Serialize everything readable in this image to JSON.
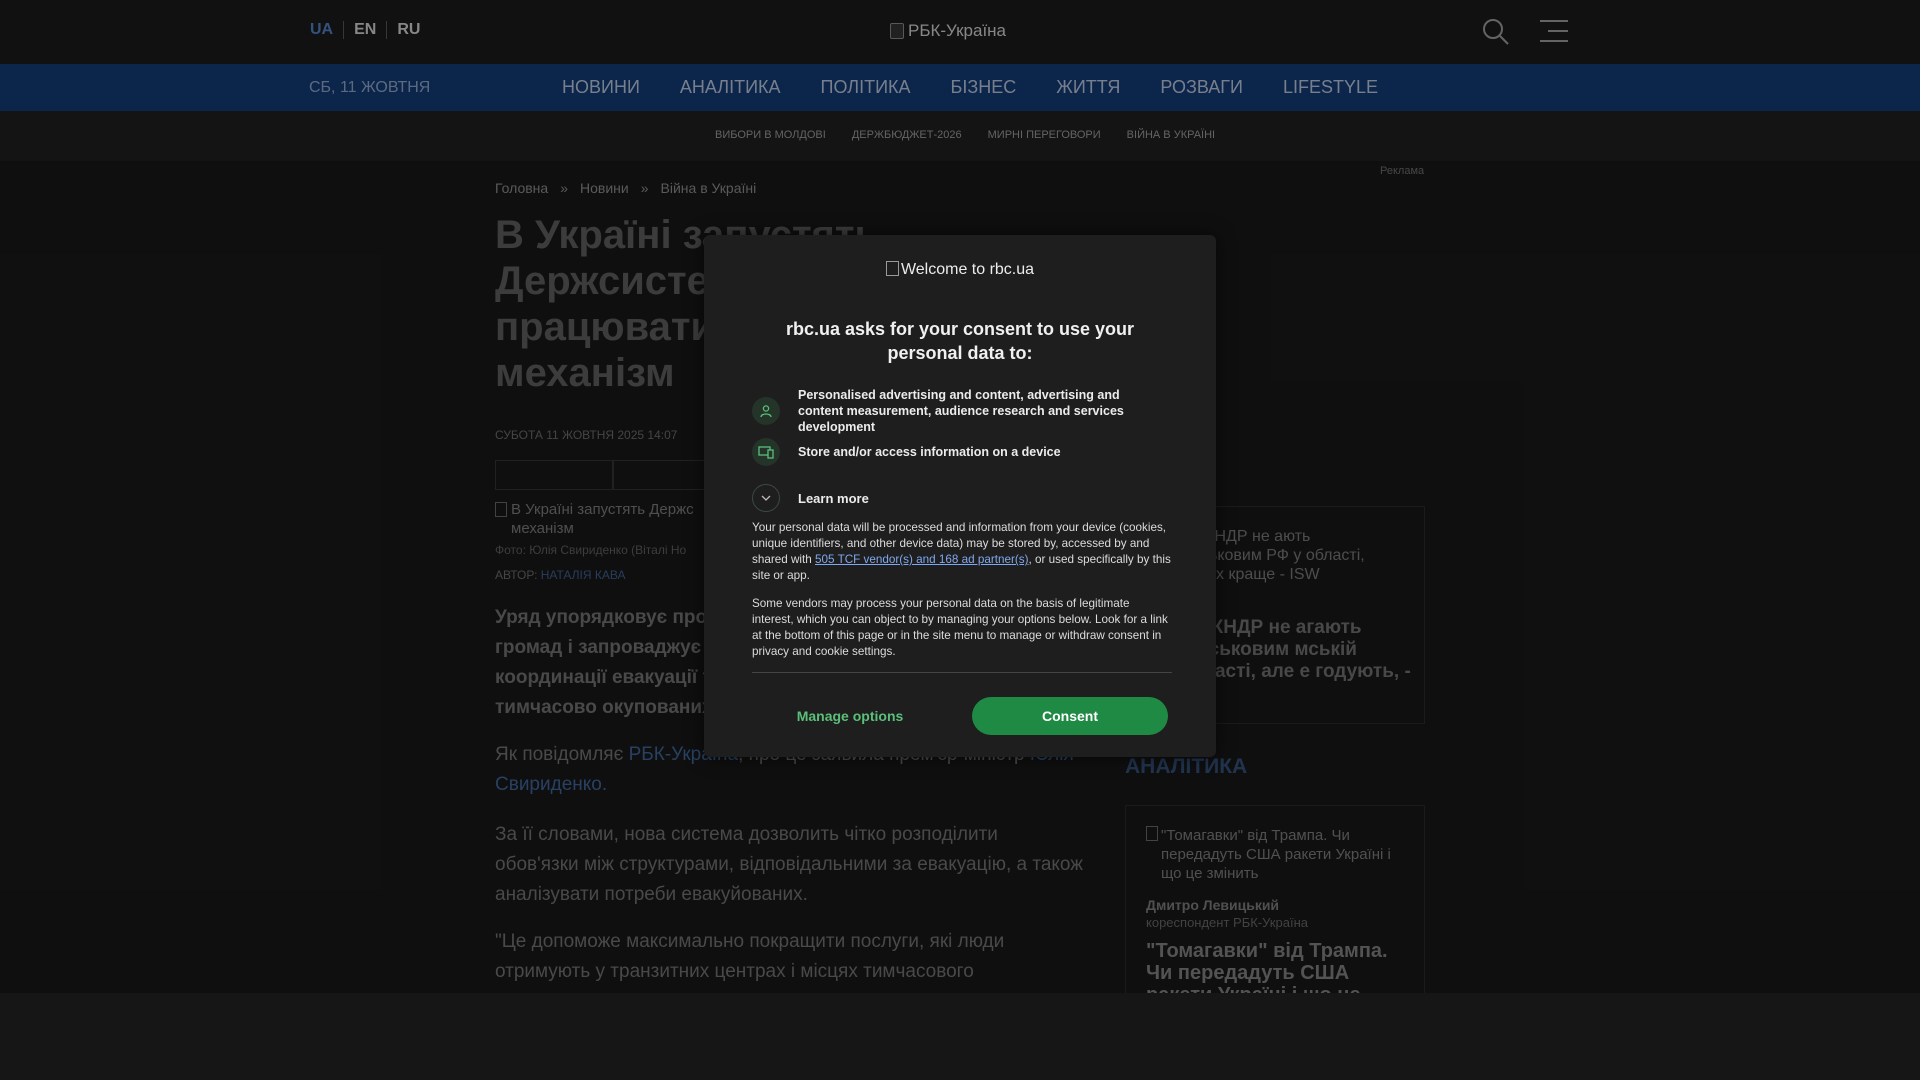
{
  "header": {
    "languages": [
      {
        "label": "UA",
        "active": true
      },
      {
        "label": "EN",
        "active": false
      },
      {
        "label": "RU",
        "active": false
      }
    ],
    "logo_alt": "РБК-Україна",
    "search_icon": "search-icon",
    "menu_icon": "hamburger-menu-icon"
  },
  "nav": {
    "date": "СБ, 11 ЖОВТНЯ",
    "items": [
      "НОВИНИ",
      "АНАЛІТИКА",
      "ПОЛІТИКА",
      "БІЗНЕС",
      "ЖИТТЯ",
      "РОЗВАГИ",
      "LIFESTYLE"
    ]
  },
  "tags": [
    "ВИБОРИ В МОЛДОВІ",
    "ДЕРЖБЮДЖЕТ-2026",
    "МИРНІ ПЕРЕГОВОРИ",
    "ВІЙНА В УКРАЇНІ"
  ],
  "ad_label": "Реклама",
  "breadcrumb": {
    "items": [
      "Головна",
      "Новини",
      "Війна в Україні"
    ],
    "separator": "»"
  },
  "article": {
    "headline_line1": "В Україні запустять",
    "headline_line2": "Держсисте",
    "headline_line3": "працювати",
    "headline_line4": "механізм",
    "date": "СУБОТА 11 ЖОВТНЯ 2025 14:07",
    "hero_alt": "В Україні запустять Держс механізм",
    "photo_credit": "Фото: Юлія Свириденко (Віталі Но",
    "author_label": "АВТОР:",
    "author_name": "НАТАЛІЯ КАВА",
    "lead_line1": "Уряд упорядковує проц",
    "lead_line2": "громад і запроваджує д",
    "lead_line3": "координації евакуації т",
    "lead_line4": "тимчасово окупованих",
    "p2_prefix": "Як повідомляє",
    "p2_link1": "РБК-Україна",
    "p2_middle": ", про це заявила прем'єр-міністр",
    "p2_link2_part1": "Юлія",
    "p2_link2_part2": "Свириденко.",
    "p3": "За її словами, нова система дозволить чітко розподілити обов'язки між структурами, відповідальними за евакуацію, а також аналізувати потреби евакуйованих.",
    "p4": "\"Це допоможе максимально покращити послуги, які люди отримують у транзитних центрах і місцях тимчасового"
  },
  "sidebar": {
    "card1_alt": "и з КНДР не ають військовим РФ у області, але їх краще - ISW",
    "card1_title": "и з КНДР не агають військовим мській області, але е годують, - ISW",
    "section_title": "АНАЛІТИКА",
    "card2_alt": "\"Томагавки\" від Трампа. Чи передадуть США ракети Україні і що це змінить",
    "card2_author": "Дмитро Левицький",
    "card2_role": "кореспондент РБК-Україна",
    "card2_title": "\"Томагавки\" від Трампа. Чи передадуть США ракети Україні і що це"
  },
  "consent": {
    "logo_alt": "Welcome to rbc.ua",
    "heading": "rbc.ua asks for your consent to use your personal data to:",
    "purposes": [
      {
        "icon": "person-icon",
        "text": "Personalised advertising and content, advertising and content measurement, audience research and services development"
      },
      {
        "icon": "device-icon",
        "text": "Store and/or access information on a device"
      }
    ],
    "learn_more": "Learn more",
    "body1_prefix": "Your personal data will be processed and information from your device (cookies, unique identifiers, and other device data) may be stored by, accessed by and shared with",
    "body1_link": "505 TCF vendor(s) and 168 ad partner(s)",
    "body1_suffix": ", or used specifically by this site or app.",
    "body2": "Some vendors may process your personal data on the basis of legitimate interest, which you can object to by managing your options below. Look for a link at the bottom of this page or in the site menu to manage or withdraw consent in privacy and cookie settings.",
    "manage_label": "Manage options",
    "consent_label": "Consent",
    "accent_color": "#1f8a44"
  }
}
